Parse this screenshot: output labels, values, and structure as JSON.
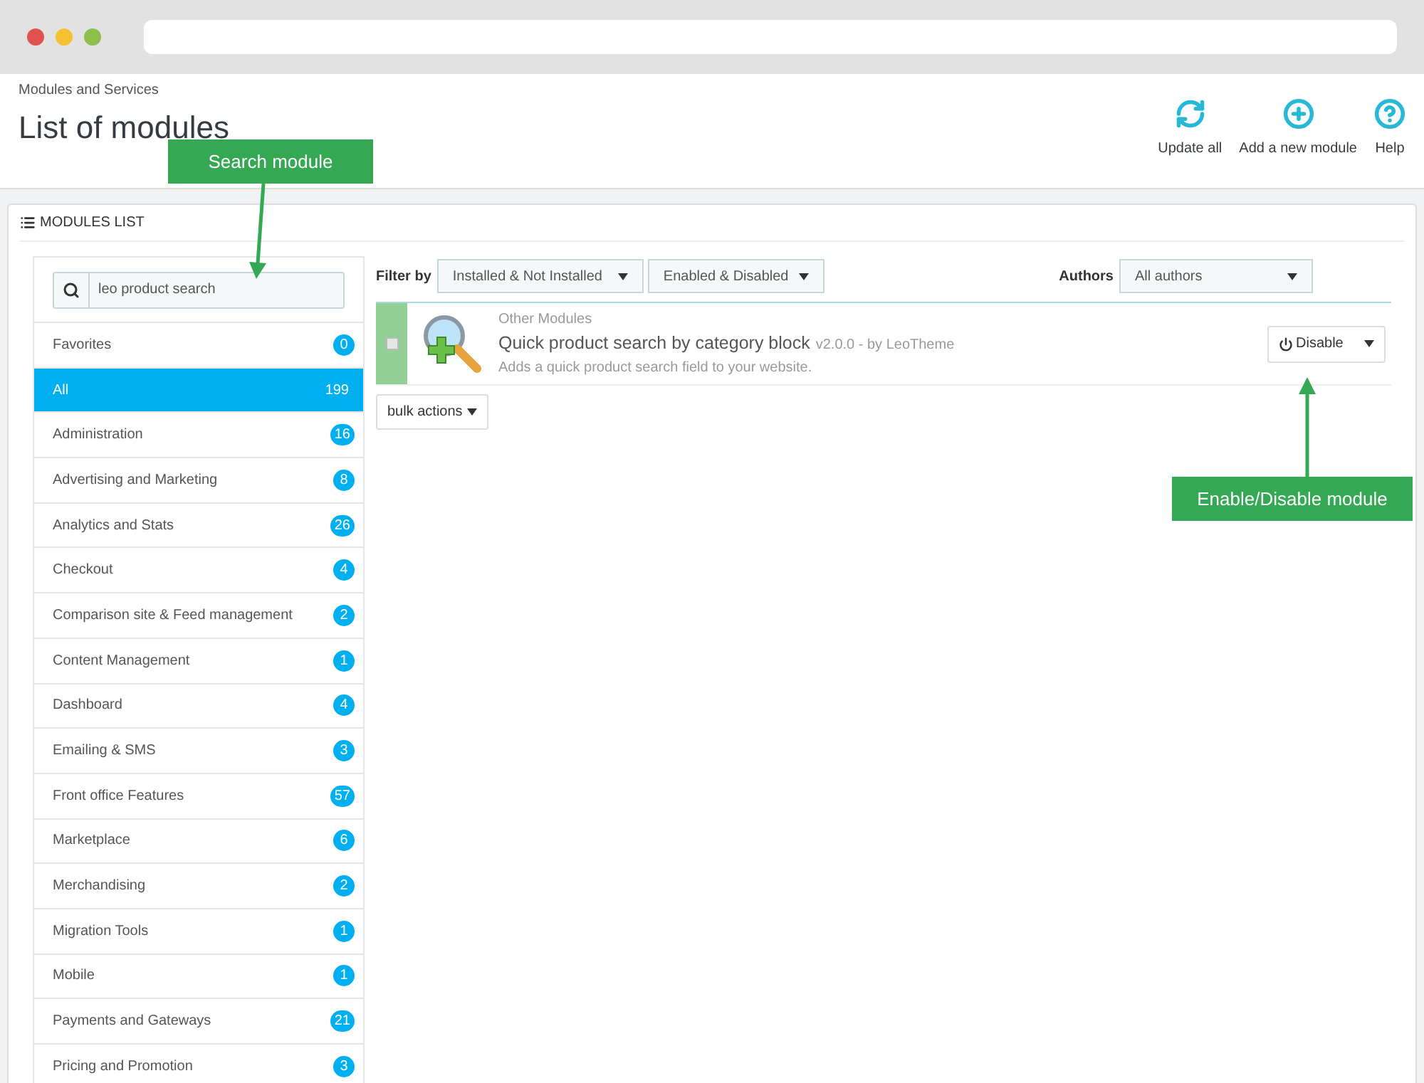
{
  "breadcrumb": "Modules and Services",
  "title": "List of modules",
  "header_actions": [
    {
      "kind": "refresh",
      "label": "Update all"
    },
    {
      "kind": "add",
      "label": "Add a new module"
    },
    {
      "kind": "help",
      "label": "Help"
    }
  ],
  "panel": {
    "title": "MODULES LIST"
  },
  "search": {
    "value": "leo product search"
  },
  "categories": [
    {
      "label": "Favorites",
      "count": "0",
      "selected": false
    },
    {
      "label": "All",
      "count": "199",
      "selected": true
    },
    {
      "label": "Administration",
      "count": "16",
      "selected": false
    },
    {
      "label": "Advertising and Marketing",
      "count": "8",
      "selected": false
    },
    {
      "label": "Analytics and Stats",
      "count": "26",
      "selected": false
    },
    {
      "label": "Checkout",
      "count": "4",
      "selected": false
    },
    {
      "label": "Comparison site & Feed management",
      "count": "2",
      "selected": false
    },
    {
      "label": "Content Management",
      "count": "1",
      "selected": false
    },
    {
      "label": "Dashboard",
      "count": "4",
      "selected": false
    },
    {
      "label": "Emailing & SMS",
      "count": "3",
      "selected": false
    },
    {
      "label": "Front office Features",
      "count": "57",
      "selected": false
    },
    {
      "label": "Marketplace",
      "count": "6",
      "selected": false
    },
    {
      "label": "Merchandising",
      "count": "2",
      "selected": false
    },
    {
      "label": "Migration Tools",
      "count": "1",
      "selected": false
    },
    {
      "label": "Mobile",
      "count": "1",
      "selected": false
    },
    {
      "label": "Payments and Gateways",
      "count": "21",
      "selected": false
    },
    {
      "label": "Pricing and Promotion",
      "count": "3",
      "selected": false
    }
  ],
  "filters": {
    "label": "Filter by",
    "status": "Installed & Not Installed",
    "enabled": "Enabled & Disabled",
    "authors_label": "Authors",
    "authors": "All authors"
  },
  "modules": [
    {
      "checked": false,
      "category": "Other Modules",
      "name": "Quick product search by category block",
      "meta": "v2.0.0 - by LeoTheme",
      "description": "Adds a quick product search field to your website.",
      "action": "Disable"
    }
  ],
  "bulk_actions": "bulk actions",
  "callouts": [
    {
      "kind": "search",
      "text": "Search module"
    },
    {
      "kind": "toggle",
      "text": "Enable/Disable module"
    }
  ]
}
